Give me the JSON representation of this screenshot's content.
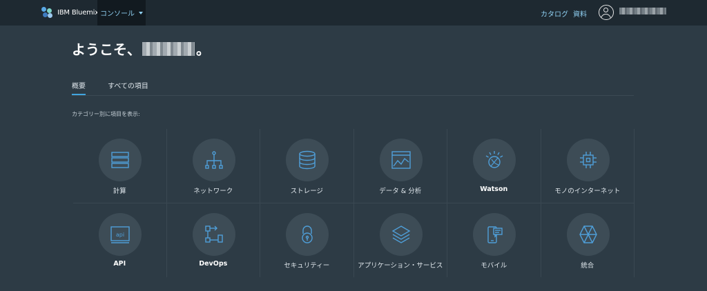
{
  "topbar": {
    "brand": "IBM Bluemix",
    "console_label": "コンソール",
    "catalog_label": "カタログ",
    "docs_label": "資料"
  },
  "welcome": {
    "prefix": "ようこそ、",
    "suffix": "。"
  },
  "tabs": [
    {
      "label": "概要",
      "active": true
    },
    {
      "label": "すべての項目",
      "active": false
    }
  ],
  "caption": "カテゴリー別に項目を表示:",
  "categories": [
    {
      "label": "計算",
      "icon": "server-stack-icon",
      "bold": false
    },
    {
      "label": "ネットワーク",
      "icon": "network-icon",
      "bold": false
    },
    {
      "label": "ストレージ",
      "icon": "database-icon",
      "bold": false
    },
    {
      "label": "データ & 分析",
      "icon": "analytics-chart-icon",
      "bold": false
    },
    {
      "label": "Watson",
      "icon": "watson-icon",
      "bold": true
    },
    {
      "label": "モノのインターネット",
      "icon": "chip-icon",
      "bold": false
    },
    {
      "label": "API",
      "icon": "api-icon",
      "bold": true
    },
    {
      "label": "DevOps",
      "icon": "devops-icon",
      "bold": true
    },
    {
      "label": "セキュリティー",
      "icon": "padlock-icon",
      "bold": false
    },
    {
      "label": "アプリケーション・サービス",
      "icon": "layers-icon",
      "bold": false
    },
    {
      "label": "モバイル",
      "icon": "mobile-icon",
      "bold": false
    },
    {
      "label": "統合",
      "icon": "integration-icon",
      "bold": false
    }
  ],
  "colors": {
    "background": "#2d3b45",
    "topbar": "#1e2931",
    "accent": "#41a5e0",
    "icon_stroke": "#4f9fd9"
  }
}
